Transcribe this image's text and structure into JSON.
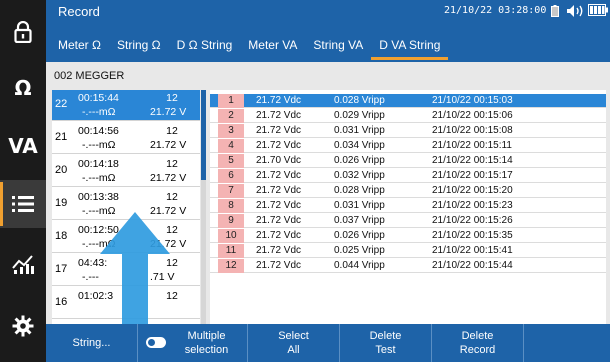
{
  "app": {
    "title": "Record",
    "datetime": "21/10/22 03:28:00"
  },
  "rail": [
    {
      "icon": "lock-icon",
      "label": ""
    },
    {
      "icon": "ohm-icon",
      "label": "Ω"
    },
    {
      "icon": "va-icon",
      "label": "VA"
    },
    {
      "icon": "list-icon",
      "label": "",
      "selected": true
    },
    {
      "icon": "chart-icon",
      "label": ""
    },
    {
      "icon": "gear-icon",
      "label": ""
    }
  ],
  "header_icons": [
    "battery-icon",
    "speaker-icon",
    "battery-full-icon"
  ],
  "tabs": [
    {
      "label": "Meter Ω",
      "active": false
    },
    {
      "label": "String Ω",
      "active": false
    },
    {
      "label": "D Ω String",
      "active": false
    },
    {
      "label": "Meter VA",
      "active": false
    },
    {
      "label": "String VA",
      "active": false
    },
    {
      "label": "D VA String",
      "active": true
    }
  ],
  "subtitle": "002 MEGGER",
  "records": [
    {
      "id": "22",
      "time": "00:15:44",
      "count": "12",
      "res": "-.---mΩ",
      "volt": "21.72 V",
      "selected": true
    },
    {
      "id": "21",
      "time": "00:14:56",
      "count": "12",
      "res": "-.---mΩ",
      "volt": "21.72 V"
    },
    {
      "id": "20",
      "time": "00:14:18",
      "count": "12",
      "res": "-.---mΩ",
      "volt": "21.72 V"
    },
    {
      "id": "19",
      "time": "00:13:38",
      "count": "12",
      "res": "-.---mΩ",
      "volt": "21.72 V"
    },
    {
      "id": "18",
      "time": "00:12:50",
      "count": "12",
      "res": "-.---mΩ",
      "volt": "21.72 V"
    },
    {
      "id": "17",
      "time": "04:43:",
      "count": "12",
      "res": "-.---",
      "volt": ".71 V"
    },
    {
      "id": "16",
      "time": "01:02:3",
      "count": "12",
      "res": "",
      "volt": ""
    }
  ],
  "readings": [
    {
      "n": "1",
      "voltage": "21.72 Vdc",
      "ripple": "0.028 Vripp",
      "datetime": "21/10/22 00:15:03",
      "selected": true
    },
    {
      "n": "2",
      "voltage": "21.72 Vdc",
      "ripple": "0.029 Vripp",
      "datetime": "21/10/22 00:15:06"
    },
    {
      "n": "3",
      "voltage": "21.72 Vdc",
      "ripple": "0.031 Vripp",
      "datetime": "21/10/22 00:15:08"
    },
    {
      "n": "4",
      "voltage": "21.72 Vdc",
      "ripple": "0.034 Vripp",
      "datetime": "21/10/22 00:15:11"
    },
    {
      "n": "5",
      "voltage": "21.70 Vdc",
      "ripple": "0.026 Vripp",
      "datetime": "21/10/22 00:15:14"
    },
    {
      "n": "6",
      "voltage": "21.72 Vdc",
      "ripple": "0.032 Vripp",
      "datetime": "21/10/22 00:15:17"
    },
    {
      "n": "7",
      "voltage": "21.72 Vdc",
      "ripple": "0.028 Vripp",
      "datetime": "21/10/22 00:15:20"
    },
    {
      "n": "8",
      "voltage": "21.72 Vdc",
      "ripple": "0.031 Vripp",
      "datetime": "21/10/22 00:15:23"
    },
    {
      "n": "9",
      "voltage": "21.72 Vdc",
      "ripple": "0.037 Vripp",
      "datetime": "21/10/22 00:15:26"
    },
    {
      "n": "10",
      "voltage": "21.72 Vdc",
      "ripple": "0.026 Vripp",
      "datetime": "21/10/22 00:15:35"
    },
    {
      "n": "11",
      "voltage": "21.72 Vdc",
      "ripple": "0.025 Vripp",
      "datetime": "21/10/22 00:15:41"
    },
    {
      "n": "12",
      "voltage": "21.72 Vdc",
      "ripple": "0.044 Vripp",
      "datetime": "21/10/22 00:15:44"
    }
  ],
  "toolbar": {
    "string": "String...",
    "multiple_line1": "Multiple",
    "multiple_line2": "selection",
    "select_line1": "Select",
    "select_line2": "All",
    "delete_test_line1": "Delete",
    "delete_test_line2": "Test",
    "delete_record_line1": "Delete",
    "delete_record_line2": "Record"
  },
  "colors": {
    "header": "#1e63a8",
    "selection": "#2a86d6",
    "accent": "#f0a030",
    "index_cell": "#f4b3b3",
    "rail": "#1b1b1b",
    "annotation_arrow": "#2f9be0"
  }
}
